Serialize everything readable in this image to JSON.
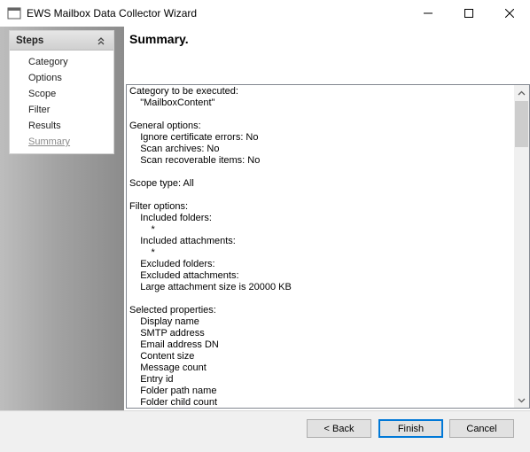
{
  "window": {
    "title": "EWS Mailbox Data Collector Wizard",
    "icons": [
      "app-icon",
      "minimize-icon",
      "maximize-icon",
      "close-icon"
    ]
  },
  "sidebar": {
    "header": "Steps",
    "collapse_icon": "chevron-double-up-icon",
    "items": [
      {
        "label": "Category"
      },
      {
        "label": "Options"
      },
      {
        "label": "Scope"
      },
      {
        "label": "Filter"
      },
      {
        "label": "Results"
      },
      {
        "label": "Summary",
        "active": true
      }
    ]
  },
  "main": {
    "title": "Summary.",
    "summary_lines": [
      "Category to be executed:",
      "    \"MailboxContent\"",
      "",
      "General options:",
      "    Ignore certificate errors: No",
      "    Scan archives: No",
      "    Scan recoverable items: No",
      "",
      "Scope type: All",
      "",
      "Filter options:",
      "    Included folders:",
      "        *",
      "    Included attachments:",
      "        *",
      "    Excluded folders:",
      "    Excluded attachments:",
      "    Large attachment size is 20000 KB",
      "",
      "Selected properties:",
      "    Display name",
      "    SMTP address",
      "    Email address DN",
      "    Content size",
      "    Message count",
      "    Entry id",
      "    Folder path name",
      "    Folder child count"
    ]
  },
  "buttons": {
    "back": "< Back",
    "finish": "Finish",
    "cancel": "Cancel"
  },
  "colors": {
    "accent": "#0078d7",
    "sidebar_gradient_start": "#bdbdbd",
    "sidebar_gradient_end": "#8c8c8c"
  }
}
